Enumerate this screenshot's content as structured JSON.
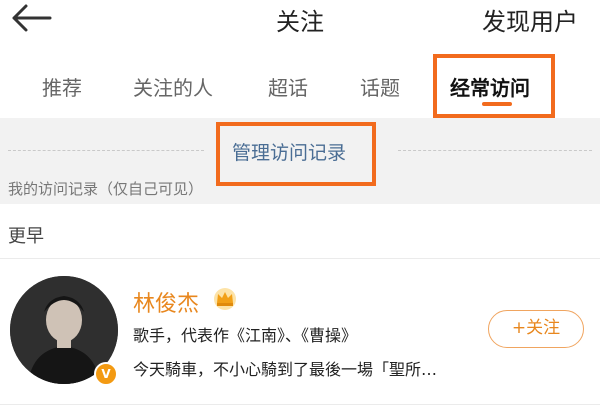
{
  "header": {
    "title": "关注",
    "discover_label": "发现用户",
    "back_icon": "back-arrow-icon"
  },
  "tabs": [
    {
      "label": "推荐",
      "active": false
    },
    {
      "label": "关注的人",
      "active": false
    },
    {
      "label": "超话",
      "active": false
    },
    {
      "label": "话题",
      "active": false
    },
    {
      "label": "经常访问",
      "active": true
    }
  ],
  "manage": {
    "link_label": "管理访问记录",
    "note": "我的访问记录（仅自己可见）"
  },
  "section_label": "更早",
  "user": {
    "name": "林俊杰",
    "description": "歌手，代表作《江南》、《曹操》",
    "latest_post": "今天騎車，不小心騎到了最後一場「聖所…",
    "follow_label": "+关注",
    "badge": "V"
  },
  "colors": {
    "accent": "#f26b1d",
    "name": "#e8871e",
    "link": "#4a6d94",
    "gray_bg": "#f2f2f2"
  }
}
